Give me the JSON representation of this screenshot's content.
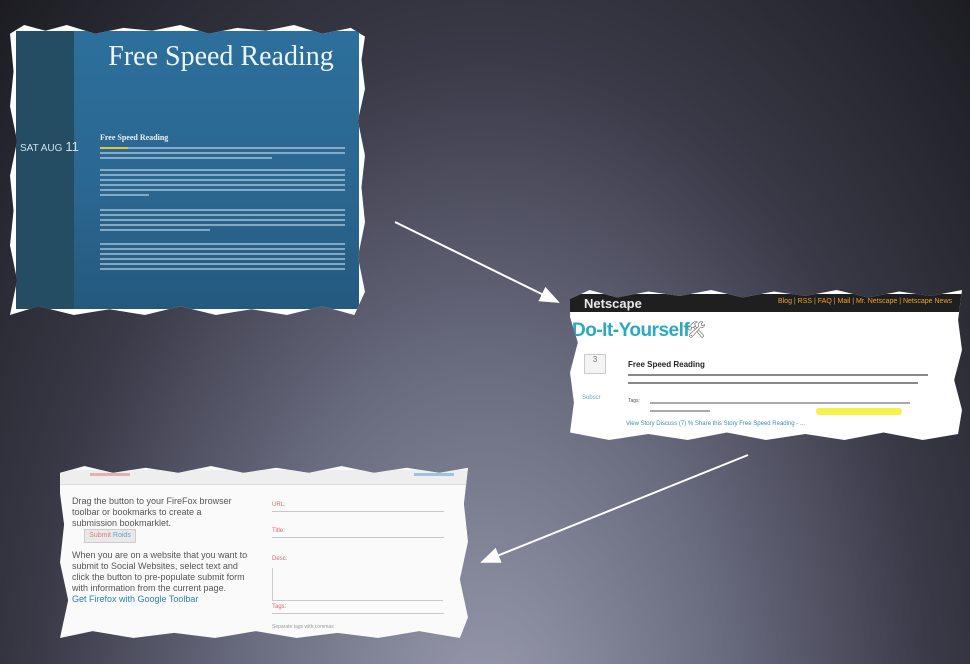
{
  "blog": {
    "title": "Free Speed Reading",
    "date_label": "SAT AUG",
    "date_day": "11",
    "post_title": "Free Speed Reading"
  },
  "netscape": {
    "logo": "Netscape",
    "nav": "Blog | RSS | FAQ | Mail | Mr. Netscape | Netscape News",
    "page_title": "Do-It-Yourself",
    "tools_icon": "tools-icon",
    "vote_count": "3",
    "story_title": "Free Speed Reading",
    "subscribe_label": "Subscr",
    "tags_label": "Tags:",
    "actions": "View Story   Discuss (7) %   Share this Story   Free Speed Reading - ..."
  },
  "form": {
    "bookmarklet_label_a": "Submit",
    "bookmarklet_label_b": "Roids",
    "instructions": "Drag the button to your FireFox browser toolbar or bookmarks to create a submission bookmarklet.",
    "instructions2": "When you are on a website that you want to submit to Social Websites, select text and click the button to pre-populate submit form with information from the current page.",
    "firefox_link": "Get Firefox with Google Toolbar",
    "field_labels": [
      "URL:",
      "Title:",
      "Desc:",
      "Tags:"
    ],
    "footnote": "Separate tags with commas"
  },
  "colors": {
    "blog_blue": "#2d6f9c",
    "netscape_teal": "#2aa9c0",
    "arrow": "#ffffff"
  }
}
